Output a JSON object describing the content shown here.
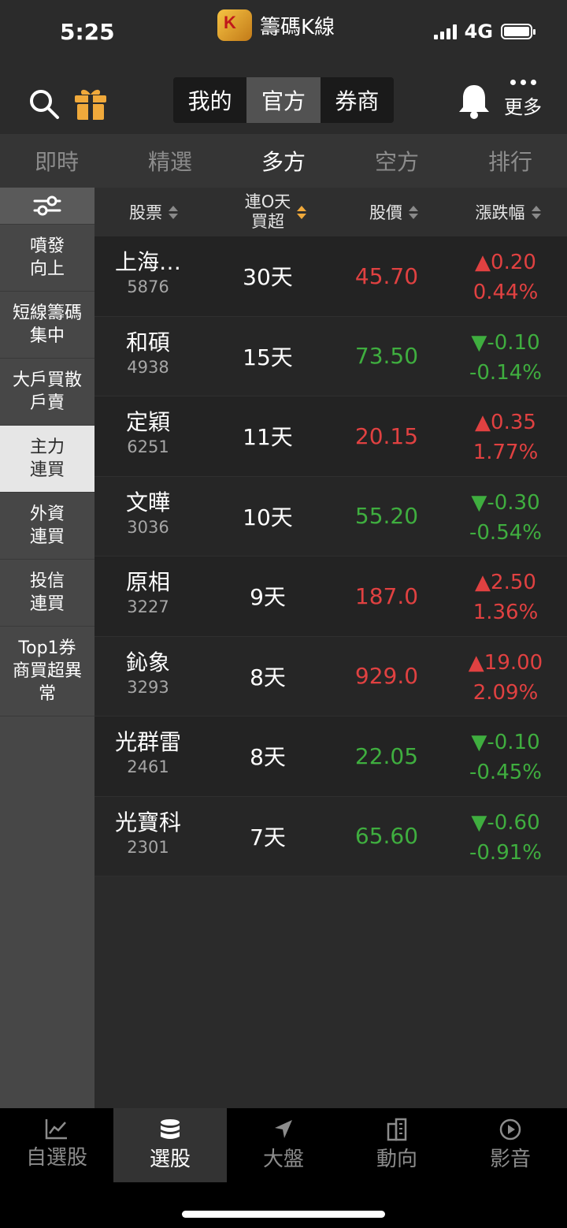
{
  "status": {
    "time": "5:25",
    "app_name": "籌碼K線",
    "network": "4G"
  },
  "header": {
    "segments": [
      "我的",
      "官方",
      "券商"
    ],
    "active_segment": 1,
    "more_label": "更多"
  },
  "tabs": [
    "即時",
    "精選",
    "多方",
    "空方",
    "排行"
  ],
  "active_tab": 2,
  "sidebar": {
    "items": [
      "噴發\n向上",
      "短線籌碼\n集中",
      "大戶買散\n戶賣",
      "主力\n連買",
      "外資\n連買",
      "投信\n連買",
      "Top1券\n商買超異\n常"
    ],
    "active": 3
  },
  "table": {
    "headers": {
      "stock": "股票",
      "days_line1": "連O天",
      "days_line2": "買超",
      "price": "股價",
      "change": "漲跌幅"
    },
    "rows": [
      {
        "name": "上海…",
        "code": "5876",
        "days": "30天",
        "price": "45.70",
        "change": "▲0.20",
        "pct": "0.44%",
        "dir": "up"
      },
      {
        "name": "和碩",
        "code": "4938",
        "days": "15天",
        "price": "73.50",
        "change": "▼-0.10",
        "pct": "-0.14%",
        "dir": "down"
      },
      {
        "name": "定穎",
        "code": "6251",
        "days": "11天",
        "price": "20.15",
        "change": "▲0.35",
        "pct": "1.77%",
        "dir": "up"
      },
      {
        "name": "文曄",
        "code": "3036",
        "days": "10天",
        "price": "55.20",
        "change": "▼-0.30",
        "pct": "-0.54%",
        "dir": "down"
      },
      {
        "name": "原相",
        "code": "3227",
        "days": "9天",
        "price": "187.0",
        "change": "▲2.50",
        "pct": "1.36%",
        "dir": "up"
      },
      {
        "name": "鈊象",
        "code": "3293",
        "days": "8天",
        "price": "929.0",
        "change": "▲19.00",
        "pct": "2.09%",
        "dir": "up"
      },
      {
        "name": "光群雷",
        "code": "2461",
        "days": "8天",
        "price": "22.05",
        "change": "▼-0.10",
        "pct": "-0.45%",
        "dir": "down"
      },
      {
        "name": "光寶科",
        "code": "2301",
        "days": "7天",
        "price": "65.60",
        "change": "▼-0.60",
        "pct": "-0.91%",
        "dir": "down"
      }
    ]
  },
  "bottom_nav": {
    "items": [
      {
        "label": "自選股",
        "icon": "chart-line-icon"
      },
      {
        "label": "選股",
        "icon": "database-icon"
      },
      {
        "label": "大盤",
        "icon": "navigation-arrow-icon"
      },
      {
        "label": "動向",
        "icon": "building-icon"
      },
      {
        "label": "影音",
        "icon": "play-circle-icon"
      }
    ],
    "active": 1
  },
  "colors": {
    "up": "#e04141",
    "down": "#3fae3f",
    "accent": "#f0a93b"
  }
}
